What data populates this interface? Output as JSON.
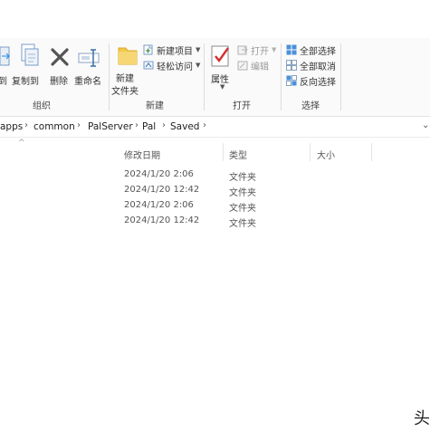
{
  "ribbon": {
    "organize": {
      "group_label": "组织",
      "move_to": "移动到",
      "copy_to": "复制到",
      "delete": "删除",
      "rename": "重命名"
    },
    "new": {
      "group_label": "新建",
      "new_folder_line1": "新建",
      "new_folder_line2": "文件夹",
      "new_item": "新建项目",
      "easy_access": "轻松访问"
    },
    "open": {
      "group_label": "打开",
      "properties": "属性",
      "open": "打开",
      "edit": "编辑"
    },
    "select": {
      "group_label": "选择",
      "select_all": "全部选择",
      "select_none": "全部取消",
      "invert_selection": "反向选择"
    }
  },
  "address": {
    "crumbs": [
      "apps",
      "common",
      "PalServer",
      "Pal",
      "Saved"
    ]
  },
  "list": {
    "columns": {
      "date": "修改日期",
      "type": "类型",
      "size": "大小"
    },
    "rows": [
      {
        "date": "2024/1/20 2:06",
        "type": "文件夹"
      },
      {
        "date": "2024/1/20 12:42",
        "type": "文件夹"
      },
      {
        "date": "2024/1/20 2:06",
        "type": "文件夹"
      },
      {
        "date": "2024/1/20 12:42",
        "type": "文件夹"
      }
    ]
  },
  "watermark": "头",
  "colors": {
    "accent": "#1e88e5",
    "delete_icon": "#555555",
    "folder": "#f2c94c"
  }
}
